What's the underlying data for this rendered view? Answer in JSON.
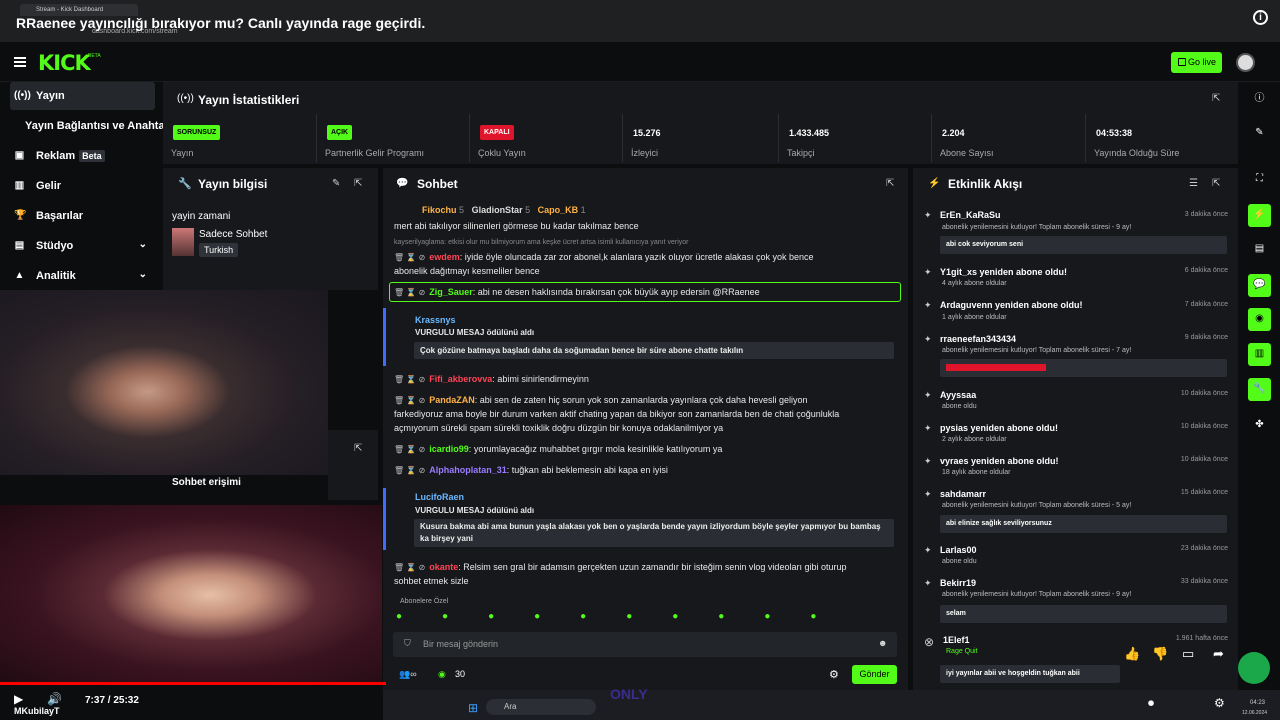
{
  "video": {
    "title": "RRaenee yayıncılığı bırakıyor mu? Canlı yayında rage geçirdi.",
    "time": "7:37 / 25:32",
    "channel": "MKubilayT",
    "progress": 0.3
  },
  "browser": {
    "tab_title": "Stream - Kick Dashboard",
    "url": "dashboard.kick.com/stream"
  },
  "header": {
    "logo": "KICK",
    "logo_badge": "BETA",
    "golive_label": "Go live"
  },
  "sidebar": {
    "items": [
      {
        "label": "Yayın"
      },
      {
        "label": "Yayın Bağlantısı ve Anahtarı"
      },
      {
        "label": "Reklam",
        "badge": "Beta"
      },
      {
        "label": "Gelir"
      },
      {
        "label": "Başarılar"
      },
      {
        "label": "Stüdyo"
      },
      {
        "label": "Analitik"
      }
    ]
  },
  "stats": {
    "title": "Yayın İstatistikleri",
    "items": [
      {
        "badge": "SORUNSUZ",
        "label": "Yayın"
      },
      {
        "badge": "AÇIK",
        "label": "Partnerlik Gelir Programı"
      },
      {
        "badge": "KAPALI",
        "label": "Çoklu Yayın"
      },
      {
        "value": "15.276",
        "label": "İzleyici"
      },
      {
        "value": "1.433.485",
        "label": "Takipçi"
      },
      {
        "value": "2.204",
        "label": "Abone Sayısı"
      },
      {
        "value": "04:53:38",
        "label": "Yayında Olduğu Süre"
      }
    ]
  },
  "info_panel": {
    "title": "Yayın bilgisi",
    "category_label": "yayin zamani",
    "category": "Sadece Sohbet",
    "language": "Turkish",
    "chat_access": "Sohbet erişimi"
  },
  "chat": {
    "title": "Sohbet",
    "top_gifters": [
      {
        "name": "Fikochu",
        "count": "5"
      },
      {
        "name": "GladionStar",
        "count": "5"
      },
      {
        "name": "Capo_KB",
        "count": "1"
      }
    ],
    "lines": [
      {
        "user": "",
        "text": "mert abi takılıyor silinenleri görmese bu kadar takılmaz bence"
      },
      {
        "user": "",
        "text": "kayserilyaglama: etkisi olur mu bilmiyorum ama keşke ücret artsa isimli kullanıcıya yanıt veriyor"
      },
      {
        "user": "ewdem",
        "text": "iyide öyle oluncada zar zor abonel,k alanlara yazık oluyor ücretle alakası çok yok bence"
      },
      {
        "user": "",
        "text": "abonelik dağıtmayı kesmeliler bence"
      },
      {
        "user": "Zig_Sauer",
        "text": "abi ne desen haklısında bırakırsan çok büyük ayıp edersin @RRaenee"
      },
      {
        "user": "Krassnys",
        "text": "VURGULU MESAJ ödülünü aldı"
      },
      {
        "user": "",
        "text": "Çok gözüne batmaya başladı daha da soğumadan bence bir süre abone chatte takılın"
      },
      {
        "user": "Fifi_akberovva",
        "text": "abimi sinirlendirmeyinn"
      },
      {
        "user": "PandaZAN",
        "text": "abi sen de zaten hiç sorun yok son zamanlarda yayınlara çok daha hevesli geliyon"
      },
      {
        "user": "",
        "text": "farkediyoruz ama boyle bir durum varken aktif chating yapan da bikiyor son zamanlarda ben de chati çoğunlukla"
      },
      {
        "user": "",
        "text": "açmıyorum sürekli spam sürekli toxiklik doğru düzgün bir konuya odaklanilmiyor ya"
      },
      {
        "user": "icardio99",
        "text": "yorumlayacağız muhabbet gırgır mola kesinlikle katılıyorum ya"
      },
      {
        "user": "Alphahoplatan_31",
        "text": "tuğkan abi beklemesin abi kapa en iyisi"
      },
      {
        "user": "LucifoRaen",
        "text": "VURGULU MESAJ ödülünü aldı"
      },
      {
        "user": "",
        "text": "Kusura bakma abi ama bunun yaşla alakası yok ben o yaşlarda bende yayın izliyordum böyle şeyler yapmıyor bu bambaş"
      },
      {
        "user": "",
        "text": "ka birşey yani"
      },
      {
        "user": "okante",
        "text": "Relsim sen gral bir adamsın gerçekten uzun zamandır bir isteğim senin vlog videoları gibi oturup"
      },
      {
        "user": "",
        "text": "sohbet etmek sizle"
      }
    ],
    "emote_label": "Abonelere Özel",
    "input_placeholder": "Bir mesaj gönderin",
    "points": "30",
    "send_label": "Gönder"
  },
  "activity": {
    "title": "Etkinlik Akışı",
    "events": [
      {
        "name": "ErEn_KaRaSu",
        "sub": "abonelik yenilemesini kutluyor! Toplam abonelik süresi - 9 ay!",
        "time": "3 dakika önce",
        "msg": "abi cok seviyorum seni"
      },
      {
        "name": "Y1git_xs yeniden abone oldu!",
        "sub": "4 aylık abone oldular",
        "time": "6 dakika önce",
        "msg": ""
      },
      {
        "name": "Ardaguvenn yeniden abone oldu!",
        "sub": "1 aylık abone oldular",
        "time": "7 dakika önce",
        "msg": ""
      },
      {
        "name": "rraeneefan343434",
        "sub": "abonelik yenilemesini kutluyor! Toplam abonelik süresi - 7 ay!",
        "time": "9 dakika önce",
        "msg": ""
      },
      {
        "name": "Ayyssaa",
        "sub": "abone oldu",
        "time": "10 dakika önce",
        "msg": ""
      },
      {
        "name": "pysias yeniden abone oldu!",
        "sub": "2 aylık abone oldular",
        "time": "10 dakika önce",
        "msg": ""
      },
      {
        "name": "vyraes yeniden abone oldu!",
        "sub": "18 aylık abone oldular",
        "time": "10 dakika önce",
        "msg": ""
      },
      {
        "name": "sahdamarr",
        "sub": "abonelik yenilemesini kutluyor! Toplam abonelik süresi - 5 ay!",
        "time": "15 dakika önce",
        "msg": "abi elinize sağlık seviliyorsunuz"
      },
      {
        "name": "Larlas00",
        "sub": "abone oldu",
        "time": "23 dakika önce",
        "msg": ""
      },
      {
        "name": "Bekirr19",
        "sub": "abonelik yenilemesini kutluyor! Toplam abonelik süresi - 9 ay!",
        "time": "33 dakika önce",
        "msg": "selam"
      },
      {
        "name": "1Elef1",
        "sub": "Rage Quit",
        "time": "1.961 hafta önce",
        "msg": "iyi yayınlar abii ve hoşgeldin tuğkan abii"
      }
    ]
  },
  "taskbar": {
    "search": "Ara",
    "time": "04:23",
    "date": "12.06.2024"
  },
  "colors": {
    "brand": "#53fc18",
    "panel": "#16181c",
    "bg": "#0b0d0f"
  }
}
